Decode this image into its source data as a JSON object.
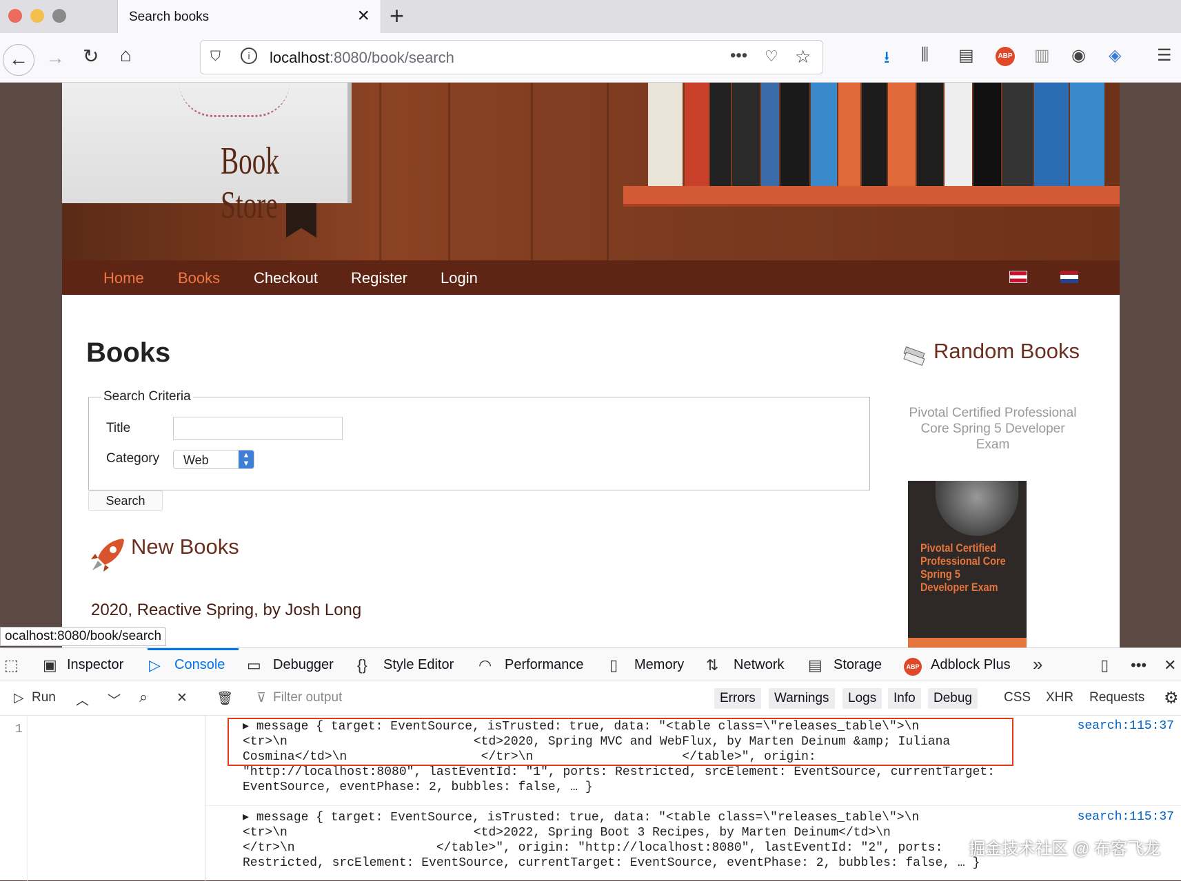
{
  "browser": {
    "tab_title": "Search books",
    "url_host": "localhost",
    "url_rest": ":8080/book/search",
    "status_url": "ocalhost:8080/book/search",
    "colors": {
      "close": "#ec6a5e",
      "minimize": "#f4bf4f",
      "zoom": "#61c554"
    }
  },
  "site": {
    "logo_text": "Book Store",
    "menu": [
      {
        "label": "Home",
        "active": true
      },
      {
        "label": "Books",
        "active": true
      },
      {
        "label": "Checkout",
        "active": false
      },
      {
        "label": "Register",
        "active": false
      },
      {
        "label": "Login",
        "active": false
      }
    ]
  },
  "main": {
    "heading": "Books",
    "search": {
      "legend": "Search Criteria",
      "title_label": "Title",
      "title_value": "",
      "category_label": "Category",
      "category_value": "Web",
      "button": "Search"
    },
    "new_books": {
      "heading": "New Books",
      "items": [
        "2020, Reactive Spring, by Josh Long"
      ]
    }
  },
  "sidebar": {
    "heading": "Random Books",
    "book_title": "Pivotal Certified Professional Core Spring 5 Developer Exam",
    "cover_text": "Pivotal Certified Professional Core Spring 5 Developer Exam"
  },
  "devtools": {
    "tabs": [
      "Inspector",
      "Console",
      "Debugger",
      "Style Editor",
      "Performance",
      "Memory",
      "Network",
      "Storage",
      "Adblock Plus"
    ],
    "selected_tab": "Console",
    "toolbar": {
      "run": "Run",
      "filter_placeholder": "Filter output",
      "filters": [
        "Errors",
        "Warnings",
        "Logs",
        "Info",
        "Debug"
      ],
      "types": [
        "CSS",
        "XHR",
        "Requests"
      ]
    },
    "line_number": "1",
    "messages": [
      {
        "location": "search:115:37",
        "lines": [
          "▸ message { target: EventSource, isTrusted: true, data: \"<table class=\\\"releases_table\\\">\\n",
          "<tr>\\n                         <td>2020, Spring MVC and WebFlux, by Marten Deinum &amp; Iuliana",
          "Cosmina</td>\\n                  </tr>\\n                    </table>\", origin:",
          "\"http://localhost:8080\", lastEventId: \"1\", ports: Restricted, srcElement: EventSource, currentTarget:",
          "EventSource, eventPhase: 2, bubbles: false, … }"
        ]
      },
      {
        "location": "search:115:37",
        "lines": [
          "▸ message { target: EventSource, isTrusted: true, data: \"<table class=\\\"releases_table\\\">\\n",
          "<tr>\\n                         <td>2022, Spring Boot 3 Recipes, by Marten Deinum</td>\\n",
          "</tr>\\n                   </table>\", origin: \"http://localhost:8080\", lastEventId: \"2\", ports:",
          "Restricted, srcElement: EventSource, currentTarget: EventSource, eventPhase: 2, bubbles: false, … }"
        ]
      }
    ]
  },
  "watermark": "掘金技术社区 @ 布客飞龙"
}
